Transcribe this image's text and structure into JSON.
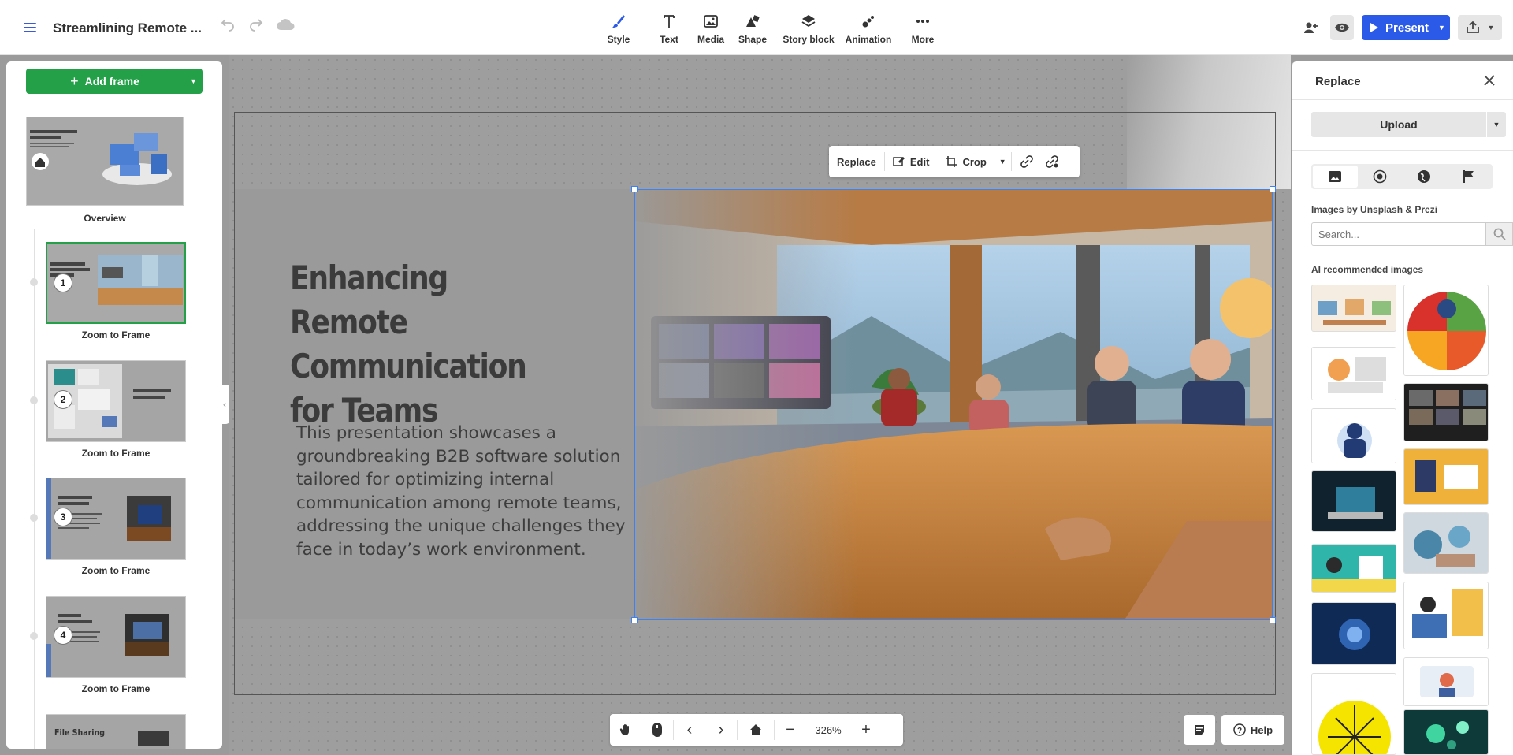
{
  "header": {
    "title": "Streamlining Remote ...",
    "tools": [
      {
        "label": "Style",
        "icon": "brush-icon"
      },
      {
        "label": "Text",
        "icon": "text-icon"
      },
      {
        "label": "Media",
        "icon": "image-icon"
      },
      {
        "label": "Shape",
        "icon": "shapes-icon"
      },
      {
        "label": "Story block",
        "icon": "layers-icon"
      },
      {
        "label": "Animation",
        "icon": "animation-icon"
      },
      {
        "label": "More",
        "icon": "more-dots-icon"
      }
    ],
    "present_label": "Present",
    "accent_color": "#2b59e8"
  },
  "left_panel": {
    "add_frame_label": "Add frame",
    "overview_label": "Overview",
    "frames": [
      {
        "number": "1",
        "label": "Zoom to Frame"
      },
      {
        "number": "2",
        "label": "Zoom to Frame"
      },
      {
        "number": "3",
        "label": "Zoom to Frame"
      },
      {
        "number": "4",
        "label": "Zoom to Frame"
      }
    ],
    "next_frame_title": "File Sharing"
  },
  "slide": {
    "title": "Enhancing Remote Communication for Teams",
    "body": "This presentation showcases a groundbreaking B2B software solution tailored for optimizing internal communication among remote teams, addressing the unique challenges they face in today’s work environment."
  },
  "image_toolbar": {
    "replace": "Replace",
    "edit": "Edit",
    "crop": "Crop"
  },
  "bottom_bar": {
    "zoom": "326%",
    "help": "Help"
  },
  "replace_panel": {
    "title": "Replace",
    "upload_label": "Upload",
    "source_label": "Images by Unsplash & Prezi",
    "search_placeholder": "Search...",
    "ai_label": "AI recommended images"
  }
}
